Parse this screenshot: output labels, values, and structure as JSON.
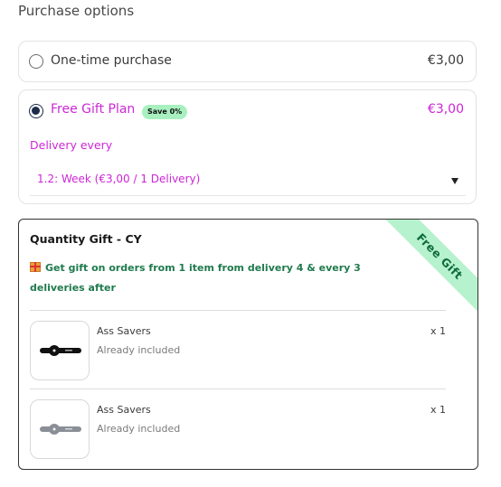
{
  "heading": "Purchase options",
  "onetime": {
    "label": "One-time purchase",
    "price": "€3,00"
  },
  "plan": {
    "label": "Free Gift Plan",
    "badge": "Save 0%",
    "price": "€3,00",
    "delivery_label": "Delivery every",
    "delivery_selected": "1.2: Week (€3,00 / 1 Delivery)"
  },
  "gift": {
    "title": "Quantity Gift - CY",
    "ribbon": "Free Gift",
    "description": "Get gift on orders from 1 item from delivery 4 & every 3 deliveries after",
    "items": [
      {
        "name": "Ass Savers",
        "status": "Already included",
        "qty": "x 1"
      },
      {
        "name": "Ass Savers",
        "status": "Already included",
        "qty": "x 1"
      }
    ]
  },
  "colors": {
    "accent": "#cc27d6",
    "badge_bg": "#a8f0c0",
    "gift_text": "#1f7a4d",
    "radio_selected": "#1c2b4a"
  },
  "icons": [
    "radio-unselected-icon",
    "radio-selected-icon",
    "dropdown-arrow-icon",
    "gift-icon"
  ]
}
